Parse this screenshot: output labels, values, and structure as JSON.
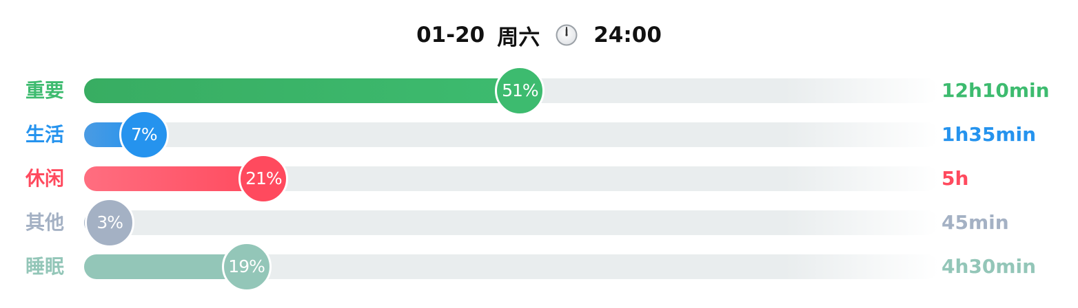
{
  "header": {
    "date": "01-20",
    "weekday": "周六",
    "clock_icon": "clock-icon",
    "time": "24:00"
  },
  "chart_data": {
    "type": "bar",
    "orientation": "horizontal",
    "categories": [
      "重要",
      "生活",
      "休闲",
      "其他",
      "睡眠"
    ],
    "values": [
      51,
      7,
      21,
      3,
      19
    ],
    "value_labels": [
      "51%",
      "7%",
      "21%",
      "3%",
      "19%"
    ],
    "durations": [
      "12h10min",
      "1h35min",
      "5h",
      "45min",
      "4h30min"
    ],
    "xlim": [
      0,
      100
    ],
    "unit": "%",
    "colors": [
      "#3dbb6f",
      "#2593ee",
      "#ff4a5e",
      "#a4b1c4",
      "#93c6b8"
    ],
    "fill_gradient_start": [
      "#38ad62",
      "#4a9be3",
      "#ff6e80",
      "#a4b1c4",
      "#93c6b8"
    ]
  }
}
